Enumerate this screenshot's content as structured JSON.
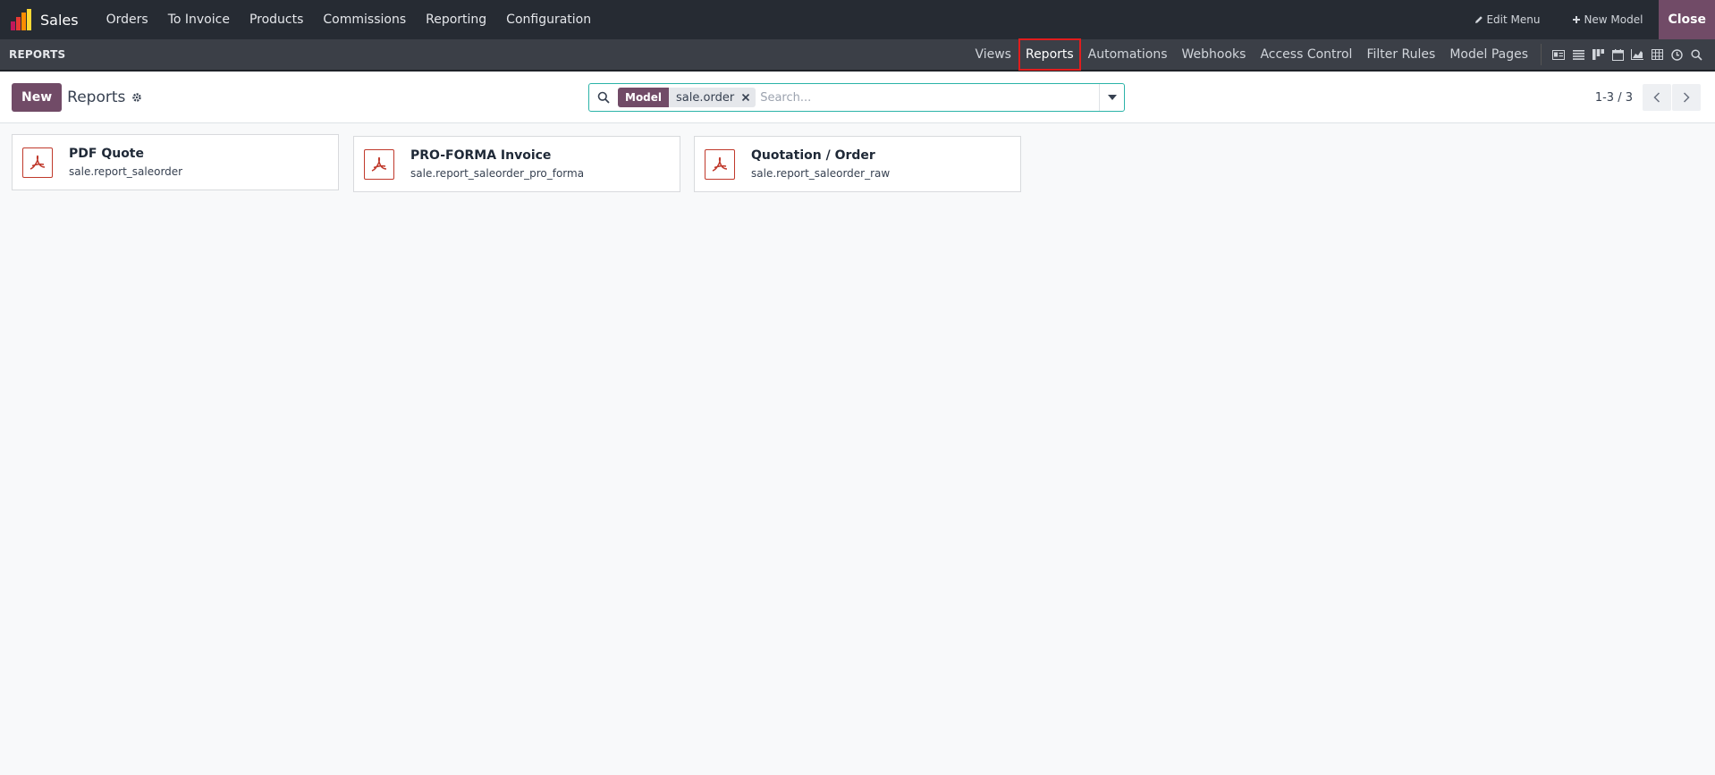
{
  "navbar": {
    "app_name": "Sales",
    "menu": [
      "Orders",
      "To Invoice",
      "Products",
      "Commissions",
      "Reporting",
      "Configuration"
    ],
    "edit_menu": "Edit Menu",
    "new_model": "New Model",
    "close": "Close"
  },
  "subbar": {
    "title": "REPORTS",
    "tabs": [
      "Views",
      "Reports",
      "Automations",
      "Webhooks",
      "Access Control",
      "Filter Rules",
      "Model Pages"
    ],
    "active_tab": "Reports",
    "view_icons": [
      "form-view-icon",
      "list-view-icon",
      "kanban-view-icon",
      "calendar-view-icon",
      "graph-view-icon",
      "pivot-view-icon",
      "activity-view-icon",
      "search-view-icon"
    ]
  },
  "control": {
    "new_label": "New",
    "title": "Reports",
    "search": {
      "facet_label": "Model",
      "facet_value": "sale.order",
      "placeholder": "Search..."
    },
    "pager": "1-3 / 3"
  },
  "reports": [
    {
      "title": "PDF Quote",
      "technical_name": "sale.report_saleorder"
    },
    {
      "title": "PRO-FORMA Invoice",
      "technical_name": "sale.report_saleorder_pro_forma"
    },
    {
      "title": "Quotation / Order",
      "technical_name": "sale.report_saleorder_raw"
    }
  ],
  "colors": {
    "brand": "#714b67",
    "navbar": "#262b33",
    "subbar": "#3b3f47",
    "pdf_red": "#c0392b",
    "active_outline": "#e11d1d",
    "search_border": "#2bb3a8"
  }
}
